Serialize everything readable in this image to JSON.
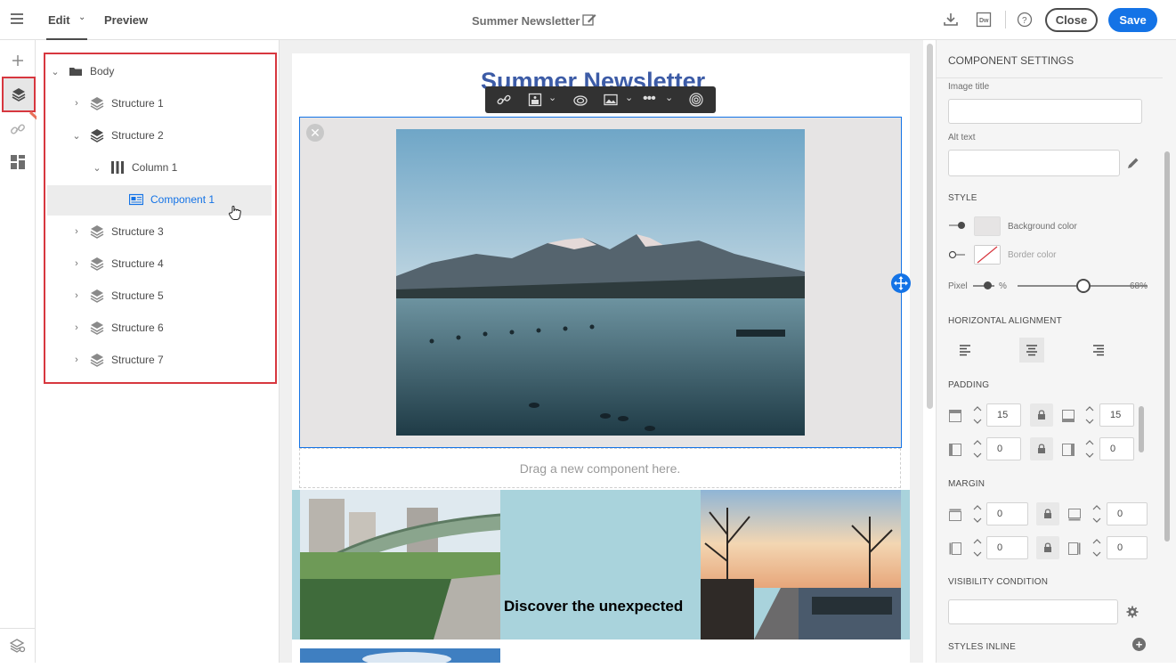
{
  "header": {
    "tabs": [
      {
        "label": "Edit",
        "active": true
      },
      {
        "label": "Preview",
        "active": false
      }
    ],
    "title": "Summer Newsletter",
    "icons": [
      "download-icon",
      "dreamweaver-icon",
      "help-icon"
    ],
    "close_label": "Close",
    "save_label": "Save",
    "accent": "#1473e6"
  },
  "rail": {
    "icons": [
      "add-icon",
      "layers-icon",
      "link-icon",
      "fragments-icon",
      "settings-stack-icon"
    ],
    "active": "layers-icon"
  },
  "tree": {
    "items": [
      {
        "label": "Body",
        "level": 0,
        "icon": "folder-icon",
        "expanded": true
      },
      {
        "label": "Structure 1",
        "level": 1,
        "icon": "layers-icon",
        "expanded": false
      },
      {
        "label": "Structure 2",
        "level": 1,
        "icon": "layers-icon",
        "expanded": true
      },
      {
        "label": "Column 1",
        "level": 2,
        "icon": "columns-icon",
        "expanded": true
      },
      {
        "label": "Component 1",
        "level": 3,
        "icon": "image-component-icon",
        "selected": true
      },
      {
        "label": "Structure 3",
        "level": 1,
        "icon": "layers-icon",
        "expanded": false
      },
      {
        "label": "Structure 4",
        "level": 1,
        "icon": "layers-icon",
        "expanded": false
      },
      {
        "label": "Structure 5",
        "level": 1,
        "icon": "layers-icon",
        "expanded": false
      },
      {
        "label": "Structure 6",
        "level": 1,
        "icon": "layers-icon",
        "expanded": false
      },
      {
        "label": "Structure 7",
        "level": 1,
        "icon": "layers-icon",
        "expanded": false
      }
    ]
  },
  "canvas": {
    "newsletter_title": "Summer Newsletter",
    "toolbar_icons": [
      "link-icon",
      "image-fit-icon",
      "chevron-down-icon",
      "creative-cloud-icon",
      "image-icon",
      "chevron-down-icon",
      "more-icon",
      "chevron-down-icon",
      "fingerprint-icon"
    ],
    "drop_zone": "Drag a new component here.",
    "discover_text": "Discover the unexpected"
  },
  "panel": {
    "title": "COMPONENT SETTINGS",
    "image_title_label": "Image title",
    "image_title_value": "",
    "alt_text_label": "Alt text",
    "alt_text_value": "",
    "style_label": "STYLE",
    "background_color_label": "Background color",
    "border_color_label": "Border color",
    "background_color": "#e6e4e4",
    "pixel_label": "Pixel",
    "percent_label": "%",
    "width_percent": "68%",
    "width_value": 0.68,
    "horizontal_alignment_label": "HORIZONTAL ALIGNMENT",
    "alignment_selected": "center",
    "padding_label": "PADDING",
    "padding": {
      "top": "15",
      "bottom": "15",
      "left": "0",
      "right": "0"
    },
    "margin_label": "MARGIN",
    "margin": {
      "top": "0",
      "bottom": "0",
      "left": "0",
      "right": "0"
    },
    "visibility_label": "VISIBILITY CONDITION",
    "visibility_value": "",
    "styles_inline_label": "STYLES INLINE"
  }
}
